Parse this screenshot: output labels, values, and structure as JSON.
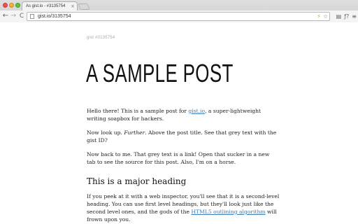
{
  "browser": {
    "tab_title": "As gist.io - #3135754",
    "tab_close": "×",
    "address": "gist.io/3135754",
    "nav": {
      "back": "←",
      "forward": "→",
      "reload": "C"
    },
    "omnibox_icons": [
      "⚡",
      "☆"
    ],
    "toolbar_icons": [
      "▤",
      "ƒ?",
      "≡"
    ]
  },
  "page": {
    "gist_id": "gist #3135754",
    "title": "A SAMPLE POST",
    "p1": {
      "before": "Hello there! This is a sample post for ",
      "link": "gist.io",
      "after": ", a super-lightweight writing soapbox for hackers."
    },
    "p2": {
      "before": "Now look up. ",
      "emph": "Further",
      "after": ". Above the post title. See that grey text with the gist ID?"
    },
    "p3": "Now back to me. That grey text is a link! Open that sucker in a new tab to see the source for this post. Also, I'm on a horse.",
    "heading": "This is a major heading",
    "p4": {
      "before": "If you peek at it with a web inspector, you'll see that it is a second-level heading. You can use first level headings, but they'll look just like the second level ones, and the gods of the ",
      "link": "HTML5 outlining algorithm",
      "after": " will frown upon you."
    }
  },
  "colors": {
    "link": "#3d7bb5",
    "gist_id": "#a8a8a8",
    "close_light": "#e9544f",
    "min_light": "#f2b52e",
    "max_light": "#62c143"
  }
}
